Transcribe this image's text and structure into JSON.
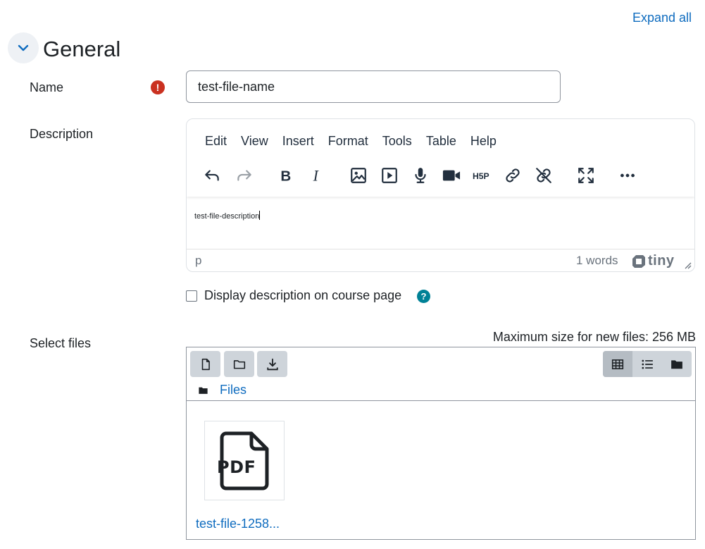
{
  "header": {
    "expand_all": "Expand all",
    "section_title": "General"
  },
  "name_field": {
    "label": "Name",
    "value": "test-file-name",
    "required_icon": "exclamation-icon"
  },
  "description": {
    "label": "Description",
    "menu": [
      "Edit",
      "View",
      "Insert",
      "Format",
      "Tools",
      "Table",
      "Help"
    ],
    "toolbar_icons": [
      "undo-icon",
      "redo-icon",
      "bold-icon",
      "italic-icon",
      "image-icon",
      "media-icon",
      "microphone-icon",
      "video-camera-icon",
      "h5p-icon",
      "link-icon",
      "unlink-icon",
      "fullscreen-icon",
      "more-icon"
    ],
    "content": "test-file-description",
    "status_path": "p",
    "word_count": "1 words",
    "brand": "tiny"
  },
  "display_description": {
    "label": "Display description on course page",
    "checked": false
  },
  "files": {
    "label": "Select files",
    "max_size": "Maximum size for new files: 256 MB",
    "breadcrumb": "Files",
    "items": [
      {
        "name": "test-file-1258...",
        "type": "PDF"
      }
    ]
  },
  "colors": {
    "link": "#0f6cbf",
    "required": "#ca3120",
    "help": "#008196"
  }
}
